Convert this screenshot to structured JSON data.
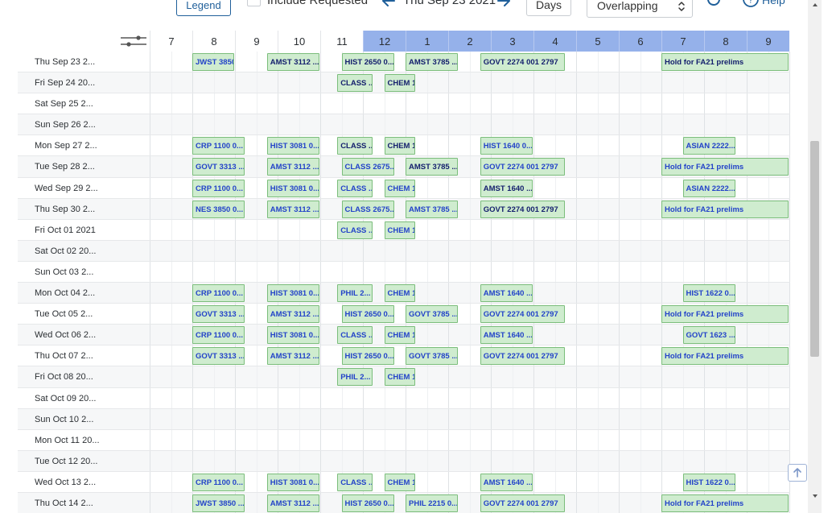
{
  "toolbar": {
    "legend_label": "Legend",
    "include_label": "Include Requested",
    "current_date": "Thu Sep 23 2021",
    "days_label": "Days",
    "overlap_label": "Overlapping",
    "help_label": "Help",
    "prev_icon": "arrow-left-icon",
    "next_icon": "arrow-right-icon",
    "refresh_icon": "refresh-icon",
    "help_icon": "help-circle-icon"
  },
  "hours": [
    {
      "label": "7",
      "highlight": false
    },
    {
      "label": "8",
      "highlight": false
    },
    {
      "label": "9",
      "highlight": false
    },
    {
      "label": "10",
      "highlight": false
    },
    {
      "label": "11",
      "highlight": false
    },
    {
      "label": "12",
      "highlight": true
    },
    {
      "label": "1",
      "highlight": true
    },
    {
      "label": "2",
      "highlight": true
    },
    {
      "label": "3",
      "highlight": true
    },
    {
      "label": "4",
      "highlight": true
    },
    {
      "label": "5",
      "highlight": true
    },
    {
      "label": "6",
      "highlight": true
    },
    {
      "label": "7",
      "highlight": true
    },
    {
      "label": "8",
      "highlight": true
    },
    {
      "label": "9",
      "highlight": true
    }
  ],
  "colors": {
    "header_highlight": "#95b1ea",
    "event_fill": "#cfeccf",
    "event_border": "#7bbd7b",
    "event_text": "#15206e",
    "event_link": "#2343c9"
  },
  "rows": [
    {
      "label": "Thu Sep 23 2...",
      "events": [
        {
          "text": "JWST 3850 ...",
          "start": 8.0,
          "end": 9.0,
          "blue": true
        },
        {
          "text": "AMST 3112 ...",
          "start": 9.75,
          "end": 11.0,
          "blue": false
        },
        {
          "text": "HIST 2650 0...",
          "start": 11.5,
          "end": 12.75,
          "blue": false
        },
        {
          "text": "AMST 3785 ...",
          "start": 13.0,
          "end": 14.25,
          "blue": false
        },
        {
          "text": "GOVT 2274 001 2797",
          "start": 14.75,
          "end": 16.75,
          "blue": false
        },
        {
          "text": "Hold for FA21 prelims",
          "start": 19.0,
          "end": 22.0,
          "blue": false
        }
      ]
    },
    {
      "label": "Fri Sep 24 20...",
      "events": [
        {
          "text": "CLASS ...",
          "start": 11.4,
          "end": 12.25,
          "blue": false
        },
        {
          "text": "CHEM 1...",
          "start": 12.5,
          "end": 13.25,
          "blue": false
        }
      ]
    },
    {
      "label": "Sat Sep 25 2...",
      "events": []
    },
    {
      "label": "Sun Sep 26 2...",
      "events": []
    },
    {
      "label": "Mon Sep 27 2...",
      "events": [
        {
          "text": "CRP 1100 0...",
          "start": 8.0,
          "end": 9.25,
          "blue": true
        },
        {
          "text": "HIST 3081 0...",
          "start": 9.75,
          "end": 11.0,
          "blue": true
        },
        {
          "text": "CLASS ...",
          "start": 11.4,
          "end": 12.25,
          "blue": false
        },
        {
          "text": "CHEM 1...",
          "start": 12.5,
          "end": 13.25,
          "blue": false
        },
        {
          "text": "HIST 1640 0...",
          "start": 14.75,
          "end": 16.0,
          "blue": true
        },
        {
          "text": "ASIAN 2222...",
          "start": 19.5,
          "end": 20.75,
          "blue": true
        }
      ]
    },
    {
      "label": "Tue Sep 28 2...",
      "events": [
        {
          "text": "GOVT 3313 ...",
          "start": 8.0,
          "end": 9.25,
          "blue": true
        },
        {
          "text": "AMST 3112 ...",
          "start": 9.75,
          "end": 11.0,
          "blue": true
        },
        {
          "text": "CLASS 2675...",
          "start": 11.5,
          "end": 12.75,
          "blue": true
        },
        {
          "text": "AMST 3785 ...",
          "start": 13.0,
          "end": 14.25,
          "blue": false
        },
        {
          "text": "GOVT 2274 001 2797",
          "start": 14.75,
          "end": 16.75,
          "blue": true
        },
        {
          "text": "Hold for FA21 prelims",
          "start": 19.0,
          "end": 22.0,
          "blue": true
        }
      ]
    },
    {
      "label": "Wed Sep 29 2...",
      "events": [
        {
          "text": "CRP 1100 0...",
          "start": 8.0,
          "end": 9.25,
          "blue": true
        },
        {
          "text": "HIST 3081 0...",
          "start": 9.75,
          "end": 11.0,
          "blue": true
        },
        {
          "text": "CLASS ...",
          "start": 11.4,
          "end": 12.25,
          "blue": true
        },
        {
          "text": "CHEM 1...",
          "start": 12.5,
          "end": 13.25,
          "blue": true
        },
        {
          "text": "AMST 1640 ...",
          "start": 14.75,
          "end": 16.0,
          "blue": false
        },
        {
          "text": "ASIAN 2222...",
          "start": 19.5,
          "end": 20.75,
          "blue": true
        }
      ]
    },
    {
      "label": "Thu Sep 30 2...",
      "events": [
        {
          "text": "NES 3850 0...",
          "start": 8.0,
          "end": 9.25,
          "blue": true
        },
        {
          "text": "AMST 3112 ...",
          "start": 9.75,
          "end": 11.0,
          "blue": true
        },
        {
          "text": "CLASS 2675...",
          "start": 11.5,
          "end": 12.75,
          "blue": true
        },
        {
          "text": "AMST 3785 ...",
          "start": 13.0,
          "end": 14.25,
          "blue": true
        },
        {
          "text": "GOVT 2274 001 2797",
          "start": 14.75,
          "end": 16.75,
          "blue": false
        },
        {
          "text": "Hold for FA21 prelims",
          "start": 19.0,
          "end": 22.0,
          "blue": true
        }
      ]
    },
    {
      "label": "Fri Oct 01 2021",
      "events": [
        {
          "text": "CLASS ...",
          "start": 11.4,
          "end": 12.25,
          "blue": true
        },
        {
          "text": "CHEM 1...",
          "start": 12.5,
          "end": 13.25,
          "blue": true
        }
      ]
    },
    {
      "label": "Sat Oct 02 20...",
      "events": []
    },
    {
      "label": "Sun Oct 03 2...",
      "events": []
    },
    {
      "label": "Mon Oct 04 2...",
      "events": [
        {
          "text": "CRP 1100 0...",
          "start": 8.0,
          "end": 9.25,
          "blue": true
        },
        {
          "text": "HIST 3081 0...",
          "start": 9.75,
          "end": 11.0,
          "blue": true
        },
        {
          "text": "PHIL 2...",
          "start": 11.4,
          "end": 12.25,
          "blue": true
        },
        {
          "text": "CHEM 1...",
          "start": 12.5,
          "end": 13.25,
          "blue": true
        },
        {
          "text": "AMST 1640 ...",
          "start": 14.75,
          "end": 16.0,
          "blue": true
        },
        {
          "text": "HIST 1622 0...",
          "start": 19.5,
          "end": 20.75,
          "blue": true
        }
      ]
    },
    {
      "label": "Tue Oct 05 2...",
      "events": [
        {
          "text": "GOVT 3313 ...",
          "start": 8.0,
          "end": 9.25,
          "blue": true
        },
        {
          "text": "AMST 3112 ...",
          "start": 9.75,
          "end": 11.0,
          "blue": true
        },
        {
          "text": "HIST 2650 0...",
          "start": 11.5,
          "end": 12.75,
          "blue": true
        },
        {
          "text": "GOVT 3785 ...",
          "start": 13.0,
          "end": 14.25,
          "blue": true
        },
        {
          "text": "GOVT 2274 001 2797",
          "start": 14.75,
          "end": 16.75,
          "blue": true
        },
        {
          "text": "Hold for FA21 prelims",
          "start": 19.0,
          "end": 22.0,
          "blue": true
        }
      ]
    },
    {
      "label": "Wed Oct 06 2...",
      "events": [
        {
          "text": "CRP 1100 0...",
          "start": 8.0,
          "end": 9.25,
          "blue": true
        },
        {
          "text": "HIST 3081 0...",
          "start": 9.75,
          "end": 11.0,
          "blue": true
        },
        {
          "text": "CLASS ...",
          "start": 11.4,
          "end": 12.25,
          "blue": true
        },
        {
          "text": "CHEM 1...",
          "start": 12.5,
          "end": 13.25,
          "blue": true
        },
        {
          "text": "AMST 1640 ...",
          "start": 14.75,
          "end": 16.0,
          "blue": true
        },
        {
          "text": "GOVT 1623 ...",
          "start": 19.5,
          "end": 20.75,
          "blue": true
        }
      ]
    },
    {
      "label": "Thu Oct 07 2...",
      "events": [
        {
          "text": "GOVT 3313 ...",
          "start": 8.0,
          "end": 9.25,
          "blue": true
        },
        {
          "text": "AMST 3112 ...",
          "start": 9.75,
          "end": 11.0,
          "blue": true
        },
        {
          "text": "HIST 2650 0...",
          "start": 11.5,
          "end": 12.75,
          "blue": true
        },
        {
          "text": "GOVT 3785 ...",
          "start": 13.0,
          "end": 14.25,
          "blue": true
        },
        {
          "text": "GOVT 2274 001 2797",
          "start": 14.75,
          "end": 16.75,
          "blue": true
        },
        {
          "text": "Hold for FA21 prelims",
          "start": 19.0,
          "end": 22.0,
          "blue": true
        }
      ]
    },
    {
      "label": "Fri Oct 08 20...",
      "events": [
        {
          "text": "PHIL 2...",
          "start": 11.4,
          "end": 12.25,
          "blue": true
        },
        {
          "text": "CHEM 1...",
          "start": 12.5,
          "end": 13.25,
          "blue": true
        }
      ]
    },
    {
      "label": "Sat Oct 09 20...",
      "events": []
    },
    {
      "label": "Sun Oct 10 2...",
      "events": []
    },
    {
      "label": "Mon Oct 11 20...",
      "events": []
    },
    {
      "label": "Tue Oct 12 20...",
      "events": []
    },
    {
      "label": "Wed Oct 13 2...",
      "events": [
        {
          "text": "CRP 1100 0...",
          "start": 8.0,
          "end": 9.25,
          "blue": true
        },
        {
          "text": "HIST 3081 0...",
          "start": 9.75,
          "end": 11.0,
          "blue": true
        },
        {
          "text": "CLASS ...",
          "start": 11.4,
          "end": 12.25,
          "blue": true
        },
        {
          "text": "CHEM 1...",
          "start": 12.5,
          "end": 13.25,
          "blue": true
        },
        {
          "text": "AMST 1640 ...",
          "start": 14.75,
          "end": 16.0,
          "blue": true
        },
        {
          "text": "HIST 1622 0...",
          "start": 19.5,
          "end": 20.75,
          "blue": true
        }
      ]
    },
    {
      "label": "Thu Oct 14 2...",
      "events": [
        {
          "text": "JWST 3850 ...",
          "start": 8.0,
          "end": 9.25,
          "blue": true
        },
        {
          "text": "AMST 3112 ...",
          "start": 9.75,
          "end": 11.0,
          "blue": true
        },
        {
          "text": "HIST 2650 0...",
          "start": 11.5,
          "end": 12.75,
          "blue": true
        },
        {
          "text": "PHIL 2215 0...",
          "start": 13.0,
          "end": 14.25,
          "blue": true
        },
        {
          "text": "GOVT 2274 001 2797",
          "start": 14.75,
          "end": 16.75,
          "blue": true
        },
        {
          "text": "Hold for FA21 prelims",
          "start": 19.0,
          "end": 22.0,
          "blue": true
        }
      ]
    }
  ]
}
